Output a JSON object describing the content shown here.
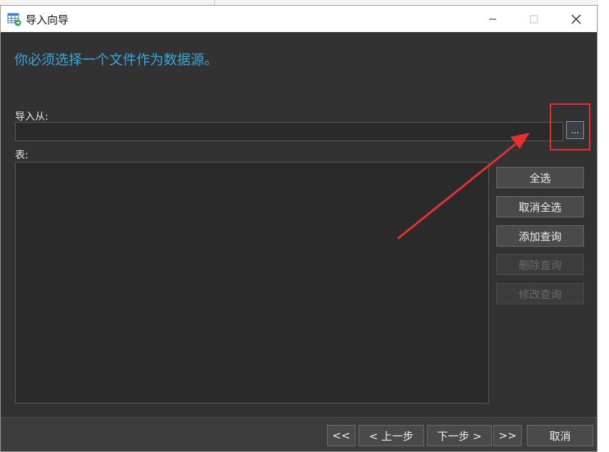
{
  "window": {
    "title": "导入向导",
    "icon": "table-import-icon"
  },
  "controls": {
    "minimize": "minimize-icon",
    "maximize": "maximize-icon",
    "close": "close-icon"
  },
  "main": {
    "heading": "你必须选择一个文件作为数据源。",
    "import_from_label": "导入从:",
    "import_from_value": "",
    "browse_label": "...",
    "table_label": "表:",
    "side_buttons": [
      {
        "label": "全选",
        "enabled": true
      },
      {
        "label": "取消全选",
        "enabled": true
      },
      {
        "label": "添加查询",
        "enabled": true
      },
      {
        "label": "删除查询",
        "enabled": false
      },
      {
        "label": "修改查询",
        "enabled": false
      }
    ]
  },
  "footer": {
    "first": "<<",
    "prev": "< 上一步",
    "next": "下一步 >",
    "last": ">>",
    "cancel": "取消"
  },
  "colors": {
    "accent": "#3aa6dc",
    "background": "#323232",
    "annotation": "#e5312f"
  }
}
